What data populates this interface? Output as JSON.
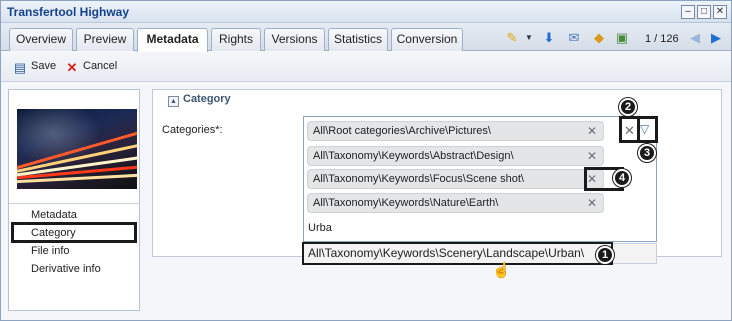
{
  "window": {
    "title": "Transfertool Highway"
  },
  "tabs": [
    {
      "label": "Overview",
      "active": false
    },
    {
      "label": "Preview",
      "active": false
    },
    {
      "label": "Metadata",
      "active": true
    },
    {
      "label": "Rights",
      "active": false
    },
    {
      "label": "Versions",
      "active": false
    },
    {
      "label": "Statistics",
      "active": false
    },
    {
      "label": "Conversion",
      "active": false
    }
  ],
  "pager": {
    "text": "1 / 126"
  },
  "toolbar": {
    "save_label": "Save",
    "cancel_label": "Cancel"
  },
  "left_nav": {
    "items": [
      "Metadata",
      "Category",
      "File info",
      "Derivative info"
    ],
    "selected": "Category"
  },
  "section": {
    "title": "Category"
  },
  "categories": {
    "label": "Categories*:",
    "chips": [
      "All\\Root categories\\Archive\\Pictures\\",
      "All\\Taxonomy\\Keywords\\Abstract\\Design\\",
      "All\\Taxonomy\\Keywords\\Focus\\Scene shot\\",
      "All\\Taxonomy\\Keywords\\Nature\\Earth\\"
    ],
    "typed_value": "Urba",
    "suggestion": "All\\Taxonomy\\Keywords\\Scenery\\Landscape\\Urban\\"
  },
  "callouts": [
    "1",
    "2",
    "3",
    "4"
  ],
  "colors": {
    "accent": "#15428b",
    "callout": "#1a1a1a"
  }
}
